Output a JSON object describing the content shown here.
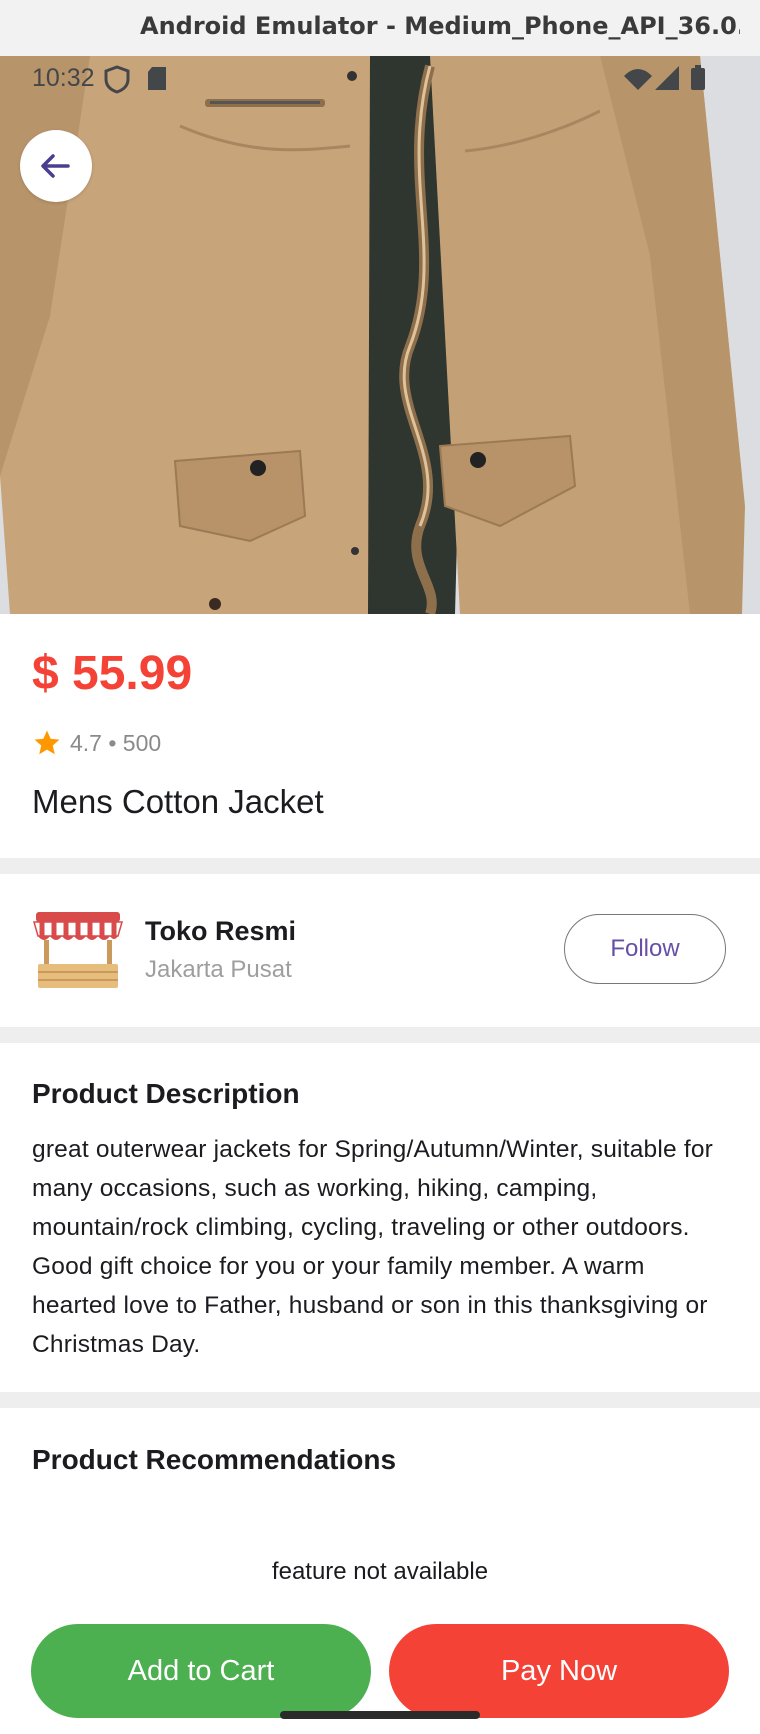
{
  "window": {
    "title": "Android Emulator - Medium_Phone_API_36.0..."
  },
  "status_bar": {
    "time": "10:32",
    "left_icons": [
      "shield-icon",
      "sd-card-icon"
    ],
    "right_icons": [
      "wifi-icon",
      "signal-icon",
      "battery-icon"
    ]
  },
  "product": {
    "image": "jacket-photo",
    "price": "$ 55.99",
    "rating": "4.7 • 500",
    "title": "Mens Cotton Jacket"
  },
  "seller": {
    "name": "Toko Resmi",
    "location": "Jakarta Pusat",
    "follow_label": "Follow"
  },
  "description": {
    "heading": "Product Description",
    "body": "great outerwear jackets for Spring/Autumn/Winter, suitable for many occasions, such as working, hiking, camping, mountain/rock climbing, cycling, traveling or other outdoors. Good gift choice for you or your family member. A warm hearted love to Father, husband or son in this thanksgiving or Christmas Day."
  },
  "recommendations": {
    "heading": "Product Recommendations",
    "message": "feature not available"
  },
  "actions": {
    "add_to_cart": "Add to Cart",
    "pay_now": "Pay Now"
  },
  "colors": {
    "price": "#f44336",
    "accent": "#6750a4",
    "cart_button": "#4caf50",
    "pay_button": "#f44336",
    "star": "#ff9800"
  }
}
